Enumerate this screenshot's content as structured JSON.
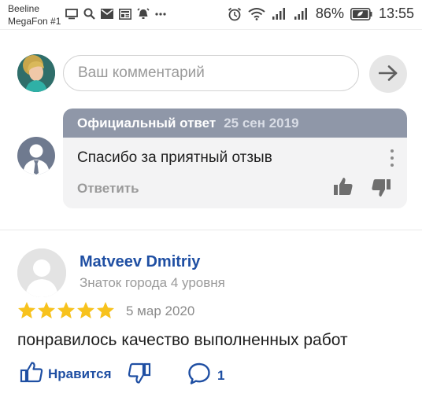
{
  "status_bar": {
    "carrier_line1": "Beeline",
    "carrier_line2": "MegaFon #1",
    "battery": "86%",
    "time": "13:55"
  },
  "comment_box": {
    "placeholder": "Ваш комментарий"
  },
  "official_reply": {
    "label": "Официальный ответ",
    "date": "25 сен 2019",
    "text": "Спасибо за приятный отзыв",
    "reply_label": "Ответить"
  },
  "review": {
    "author": "Matveev Dmitriy",
    "level": "Знаток города 4 уровня",
    "rating": 5,
    "rating_max": 5,
    "date": "5 мар 2020",
    "text": "понравилось качество выполненных работ",
    "like_label": "Нравится",
    "comment_count": "1"
  },
  "colors": {
    "accent": "#1f4fa3",
    "star": "#f7c21d",
    "reply_header": "#8f97a8"
  }
}
